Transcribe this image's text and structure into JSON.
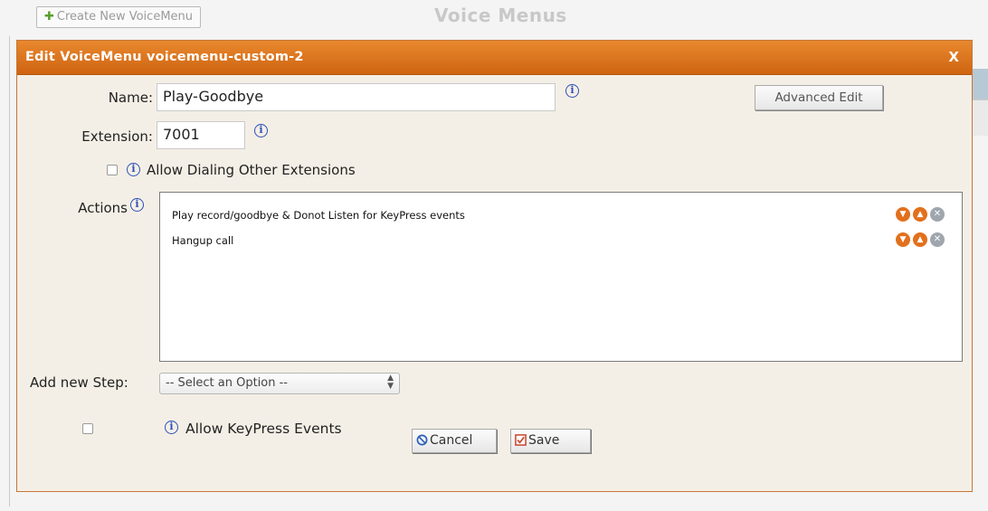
{
  "background": {
    "create_button": "Create New VoiceMenu",
    "page_title": "Voice Menus"
  },
  "dialog": {
    "title": "Edit VoiceMenu voicemenu-custom-2",
    "close": "X",
    "name_label": "Name:",
    "name_value": "Play-Goodbye",
    "extension_label": "Extension:",
    "extension_value": "7001",
    "allow_dialing_label": "Allow Dialing Other Extensions",
    "advanced_edit": "Advanced Edit",
    "actions_label": "Actions",
    "actions": [
      {
        "text": "Play record/goodbye & Donot Listen for KeyPress events"
      },
      {
        "text": "Hangup call"
      }
    ],
    "add_step_label": "Add new Step:",
    "select_value": "-- Select an Option --",
    "allow_keypress_label": "Allow KeyPress Events",
    "cancel": "Cancel",
    "save": "Save"
  },
  "colors": {
    "titlebar": "#d9711c",
    "dialog_bg": "#f4efe6",
    "info_icon": "#2c4fb8",
    "action_arrow": "#e2701c"
  }
}
